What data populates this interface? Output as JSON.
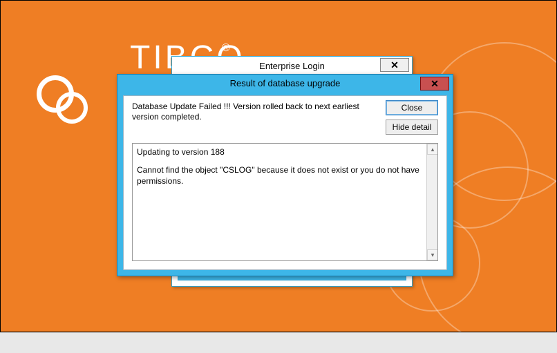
{
  "brand": {
    "text": "TIBCO",
    "registered": "®"
  },
  "login_window": {
    "title": "Enterprise Login",
    "close_glyph": "✕"
  },
  "result_window": {
    "title": "Result of database upgrade",
    "close_glyph": "✕",
    "message": "Database Update Failed !!!  Version rolled back to next earliest version completed.",
    "buttons": {
      "close": "Close",
      "hide_detail": "Hide detail"
    },
    "detail": {
      "line1": "Updating to version 188",
      "line2": "Cannot find the object \"CSLOG\" because it does not exist or you do not have permissions."
    },
    "scroll": {
      "up_glyph": "▴",
      "down_glyph": "▾"
    }
  },
  "colors": {
    "background_orange": "#ef7e24",
    "titlebar_blue": "#3db6e8",
    "close_red": "#c85050"
  }
}
